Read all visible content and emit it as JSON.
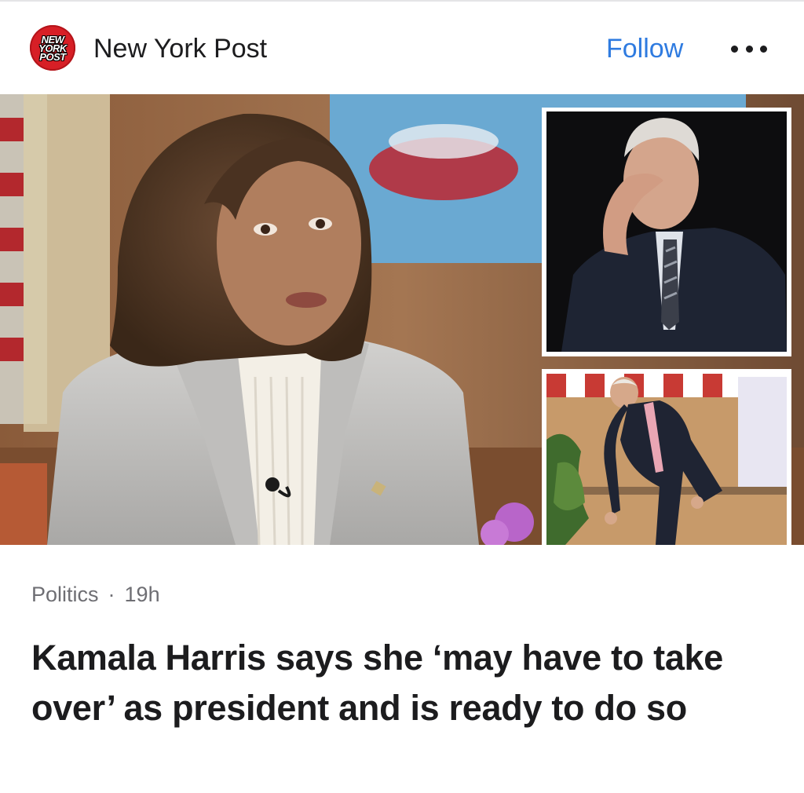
{
  "header": {
    "logo_lines": [
      "NEW",
      "YORK",
      "POST"
    ],
    "publisher": "New York Post",
    "follow_label": "Follow",
    "more_icon": "more-horizontal-icon"
  },
  "article": {
    "category": "Politics",
    "separator": "·",
    "age": "19h",
    "headline": "Kamala Harris says she ‘may have to take over’ as president and is ready to do so"
  },
  "colors": {
    "brand_red": "#d71f26",
    "follow_blue": "#2f7be0",
    "meta_gray": "#6e6e73"
  }
}
